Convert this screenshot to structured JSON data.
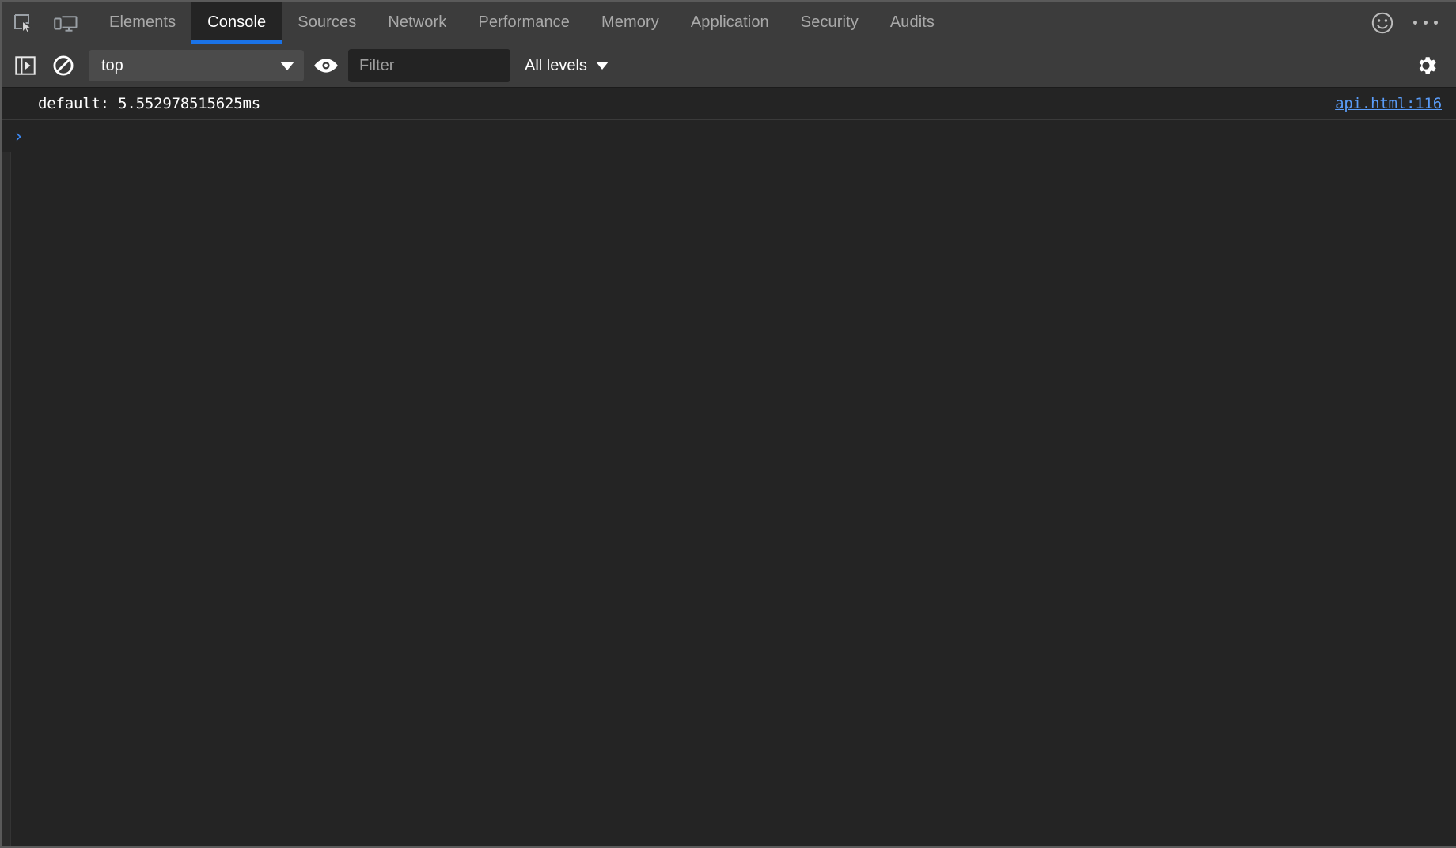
{
  "window": {
    "app": "Chrome DevTools",
    "accent_color": "#1a73e8",
    "toolbar_bg": "#3c3c3c",
    "panel_bg": "#242424"
  },
  "tabbar": {
    "inspect_icon": "inspect-element-icon",
    "device_icon": "device-toolbar-icon",
    "tabs": [
      {
        "label": "Elements",
        "active": false
      },
      {
        "label": "Console",
        "active": true
      },
      {
        "label": "Sources",
        "active": false
      },
      {
        "label": "Network",
        "active": false
      },
      {
        "label": "Performance",
        "active": false
      },
      {
        "label": "Memory",
        "active": false
      },
      {
        "label": "Application",
        "active": false
      },
      {
        "label": "Security",
        "active": false
      },
      {
        "label": "Audits",
        "active": false
      }
    ],
    "feedback_icon": "smiley-face-icon",
    "more_icon": "more-options-icon"
  },
  "toolbar": {
    "sidebar_toggle_icon": "show-console-sidebar-icon",
    "clear_icon": "clear-console-icon",
    "context": {
      "value": "top",
      "caret_icon": "chevron-down-icon"
    },
    "live_expression_icon": "eye-icon",
    "filter": {
      "value": "",
      "placeholder": "Filter"
    },
    "levels": {
      "label": "All levels",
      "caret_icon": "chevron-down-icon"
    },
    "settings_icon": "gear-icon"
  },
  "console": {
    "messages": [
      {
        "text": "default: 5.552978515625ms",
        "source": "api.html:116"
      }
    ],
    "prompt": {
      "caret": "›",
      "value": ""
    }
  }
}
